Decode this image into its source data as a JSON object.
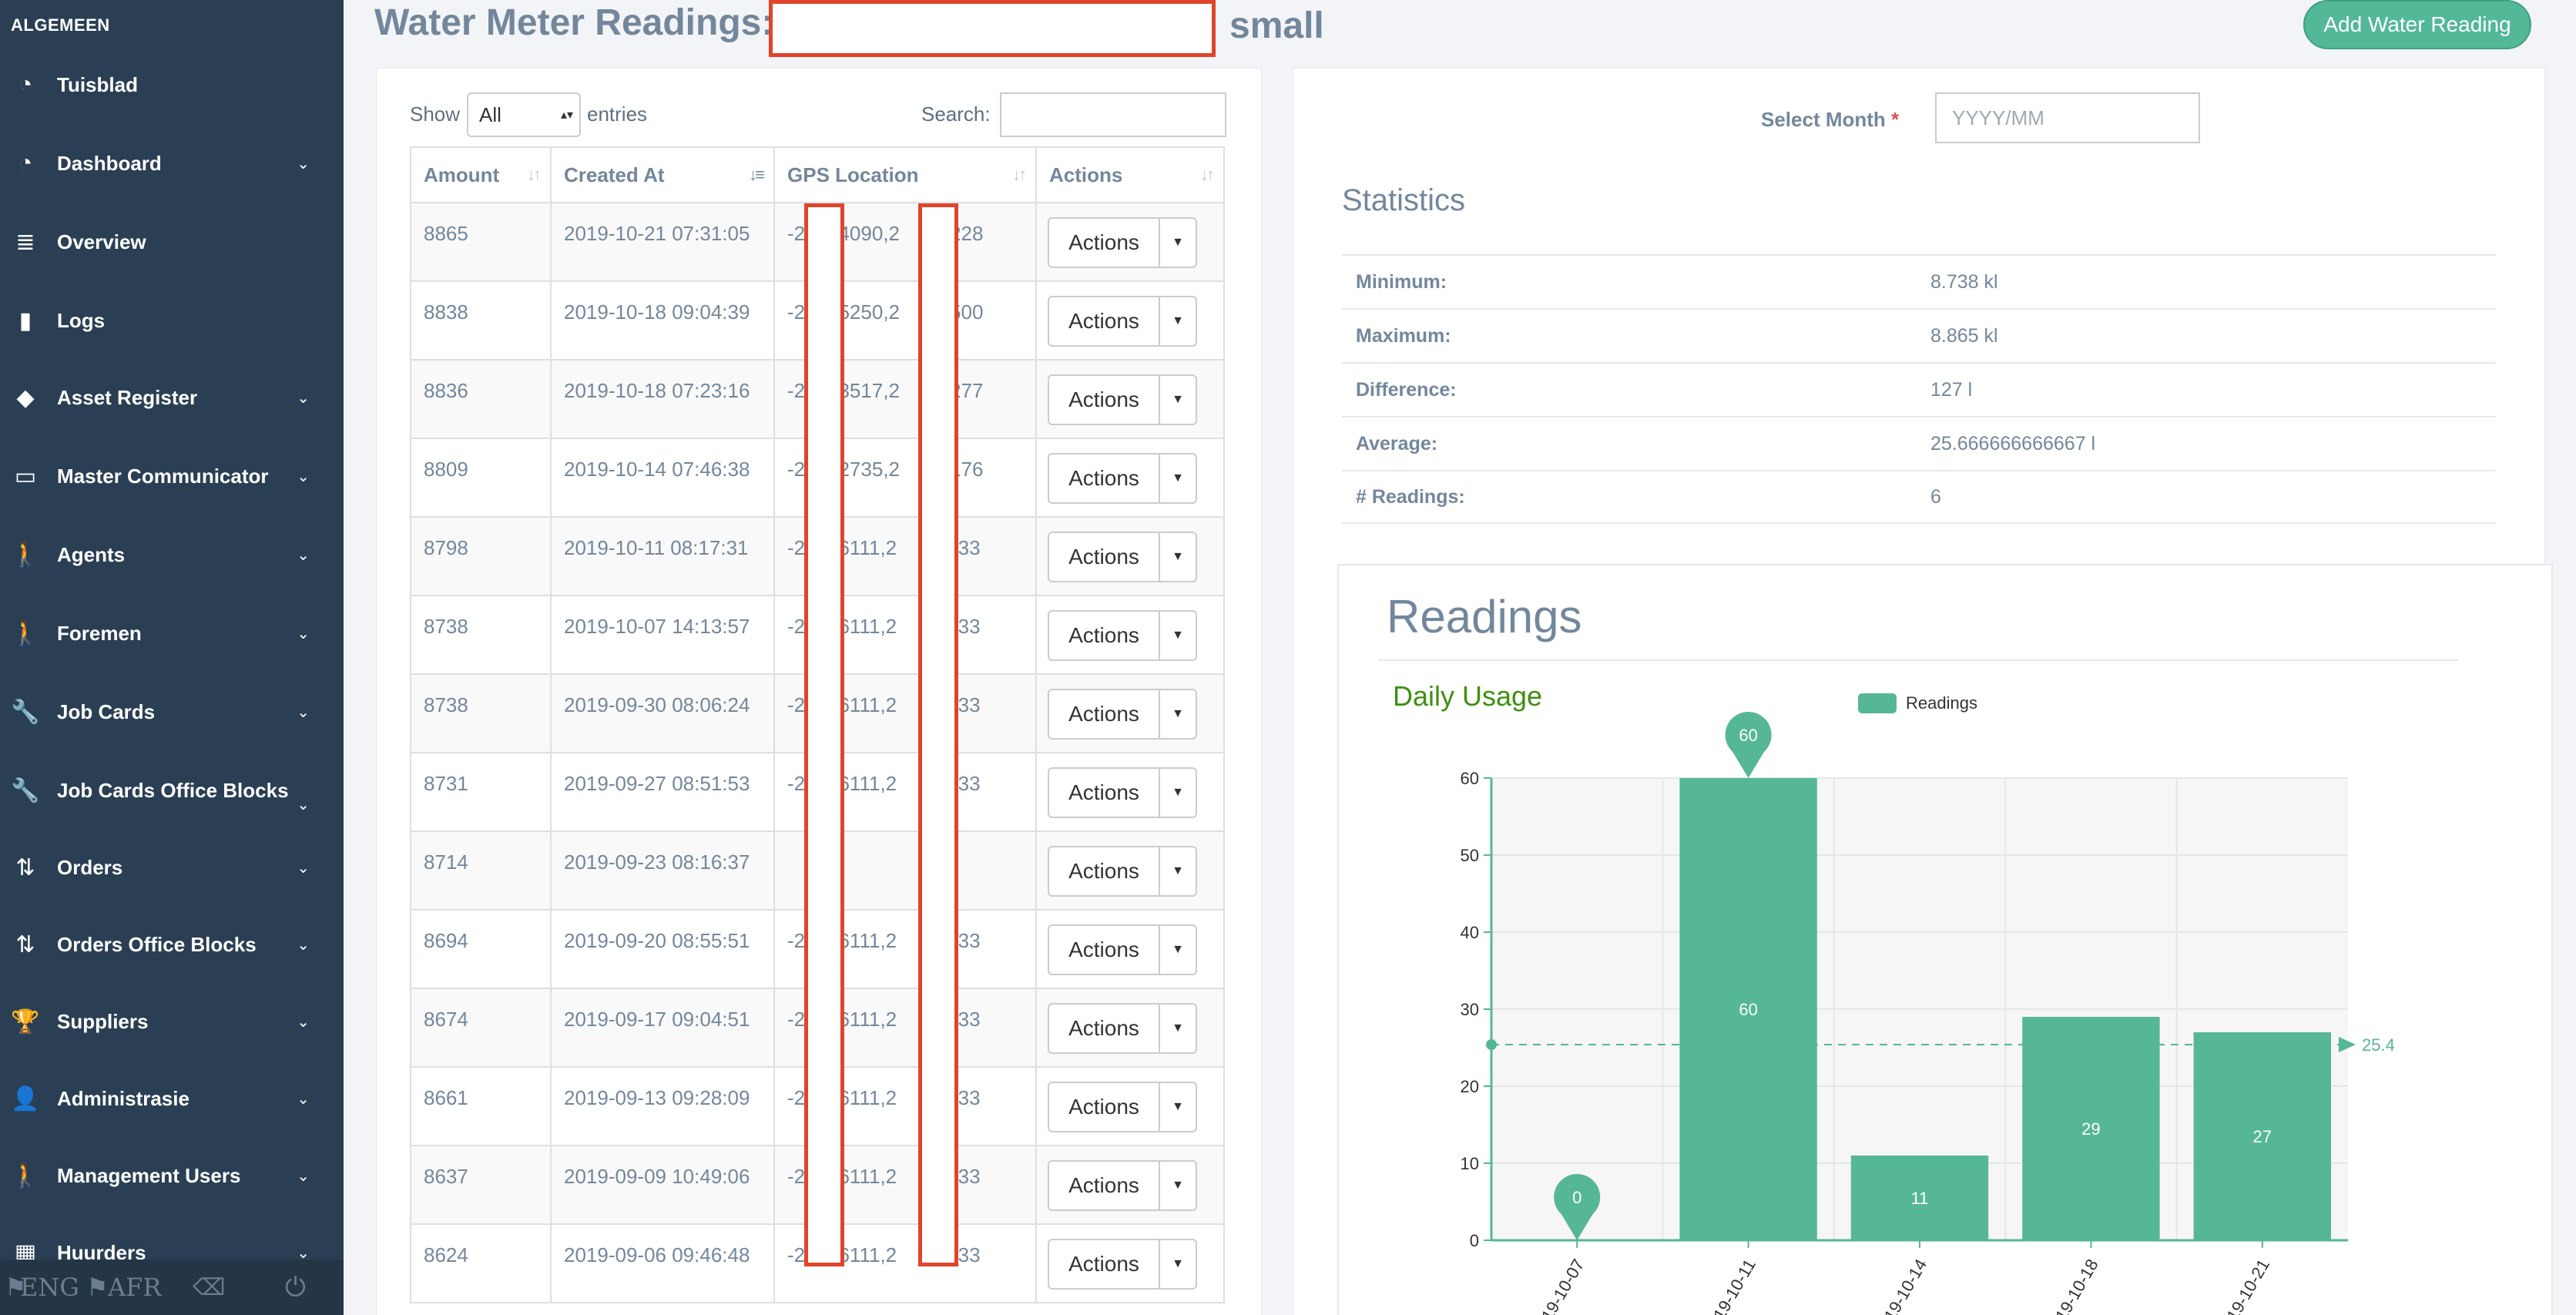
{
  "sidebar": {
    "section": "ALGEMEEN",
    "items": [
      {
        "label": "Tuisblad",
        "icon": "tachometer-icon",
        "chevron": false
      },
      {
        "label": "Dashboard",
        "icon": "tachometer-icon",
        "chevron": true
      },
      {
        "label": "Overview",
        "icon": "stack-overflow-icon",
        "chevron": false
      },
      {
        "label": "Logs",
        "icon": "file-icon",
        "chevron": false
      },
      {
        "label": "Asset Register",
        "icon": "diamond-icon",
        "chevron": true
      },
      {
        "label": "Master Communicator",
        "icon": "inbox-icon",
        "chevron": true
      },
      {
        "label": "Agents",
        "icon": "person-walking-icon",
        "chevron": true
      },
      {
        "label": "Foremen",
        "icon": "person-walking-icon",
        "chevron": true
      },
      {
        "label": "Job Cards",
        "icon": "wrench-icon",
        "chevron": true
      },
      {
        "label": "Job Cards Office Blocks",
        "icon": "wrench-icon",
        "chevron": true
      },
      {
        "label": "Orders",
        "icon": "sort-numeric-icon",
        "chevron": true
      },
      {
        "label": "Orders Office Blocks",
        "icon": "sort-numeric-icon",
        "chevron": true
      },
      {
        "label": "Suppliers",
        "icon": "trophy-icon",
        "chevron": true
      },
      {
        "label": "Administrasie",
        "icon": "user-cog-icon",
        "chevron": true
      },
      {
        "label": "Management Users",
        "icon": "person-walking-icon",
        "chevron": true
      },
      {
        "label": "Huurders",
        "icon": "table-icon",
        "chevron": true
      }
    ],
    "footer": {
      "eng": "ENG",
      "afr": "AFR"
    }
  },
  "header": {
    "title": "Water Meter Readings:",
    "title_suffix": "small",
    "add_button": "Add Water Reading"
  },
  "table": {
    "show_label": "Show",
    "show_value": "All",
    "entries_label": "entries",
    "search_label": "Search:",
    "columns": [
      "Amount",
      "Created At",
      "GPS Location",
      "Actions"
    ],
    "action_label": "Actions",
    "rows": [
      {
        "amount": "8865",
        "created": "2019-10-21 07:31:05",
        "gps": "-2    84090,2     03228"
      },
      {
        "amount": "8838",
        "created": "2019-10-18 09:04:39",
        "gps": "-2    65250,2     85500"
      },
      {
        "amount": "8836",
        "created": "2019-10-18 07:23:16",
        "gps": "-2    83517,2     04277"
      },
      {
        "amount": "8809",
        "created": "2019-10-14 07:46:38",
        "gps": "-2    82735,2     07176"
      },
      {
        "amount": "8798",
        "created": "2019-10-11 08:17:31",
        "gps": "-2    86111,2     08333"
      },
      {
        "amount": "8738",
        "created": "2019-10-07 14:13:57",
        "gps": "-2    86111,2     08333"
      },
      {
        "amount": "8738",
        "created": "2019-09-30 08:06:24",
        "gps": "-2    86111,2     08333"
      },
      {
        "amount": "8731",
        "created": "2019-09-27 08:51:53",
        "gps": "-2    86111,2     08333"
      },
      {
        "amount": "8714",
        "created": "2019-09-23 08:16:37",
        "gps": ""
      },
      {
        "amount": "8694",
        "created": "2019-09-20 08:55:51",
        "gps": "-2    86111,2     08333"
      },
      {
        "amount": "8674",
        "created": "2019-09-17 09:04:51",
        "gps": "-2    86111,2     08333"
      },
      {
        "amount": "8661",
        "created": "2019-09-13 09:28:09",
        "gps": "-2    86111,2     08333"
      },
      {
        "amount": "8637",
        "created": "2019-09-09 10:49:06",
        "gps": "-2    86111,2     08333"
      },
      {
        "amount": "8624",
        "created": "2019-09-06 09:46:48",
        "gps": "-2    86111,2     08333"
      }
    ]
  },
  "filter": {
    "month_label": "Select Month",
    "required_mark": "*",
    "month_placeholder": "YYYY/MM"
  },
  "statistics": {
    "title": "Statistics",
    "rows": [
      {
        "key": "Minimum:",
        "value": "8.738 kl"
      },
      {
        "key": "Maximum:",
        "value": "8.865 kl"
      },
      {
        "key": "Difference:",
        "value": "127 l"
      },
      {
        "key": "Average:",
        "value": "25.666666666667 l"
      },
      {
        "key": "# Readings:",
        "value": "6"
      }
    ]
  },
  "readings_panel": {
    "title": "Readings"
  },
  "chart_data": {
    "type": "bar",
    "title": "Daily Usage",
    "legend": "Readings",
    "legend_position": "top",
    "categories": [
      "2019-10-07",
      "2019-10-11",
      "2019-10-14",
      "2019-10-18",
      "2019-10-21"
    ],
    "series": [
      {
        "name": "Readings",
        "values": [
          0,
          60,
          11,
          29,
          27
        ]
      }
    ],
    "ylim": [
      0,
      60
    ],
    "yticks": [
      0,
      10,
      20,
      30,
      40,
      50,
      60
    ],
    "average_line": {
      "value": 25.4,
      "label": "25.4"
    },
    "max_marker": "60",
    "min_marker": "0",
    "color": "#55b795"
  }
}
